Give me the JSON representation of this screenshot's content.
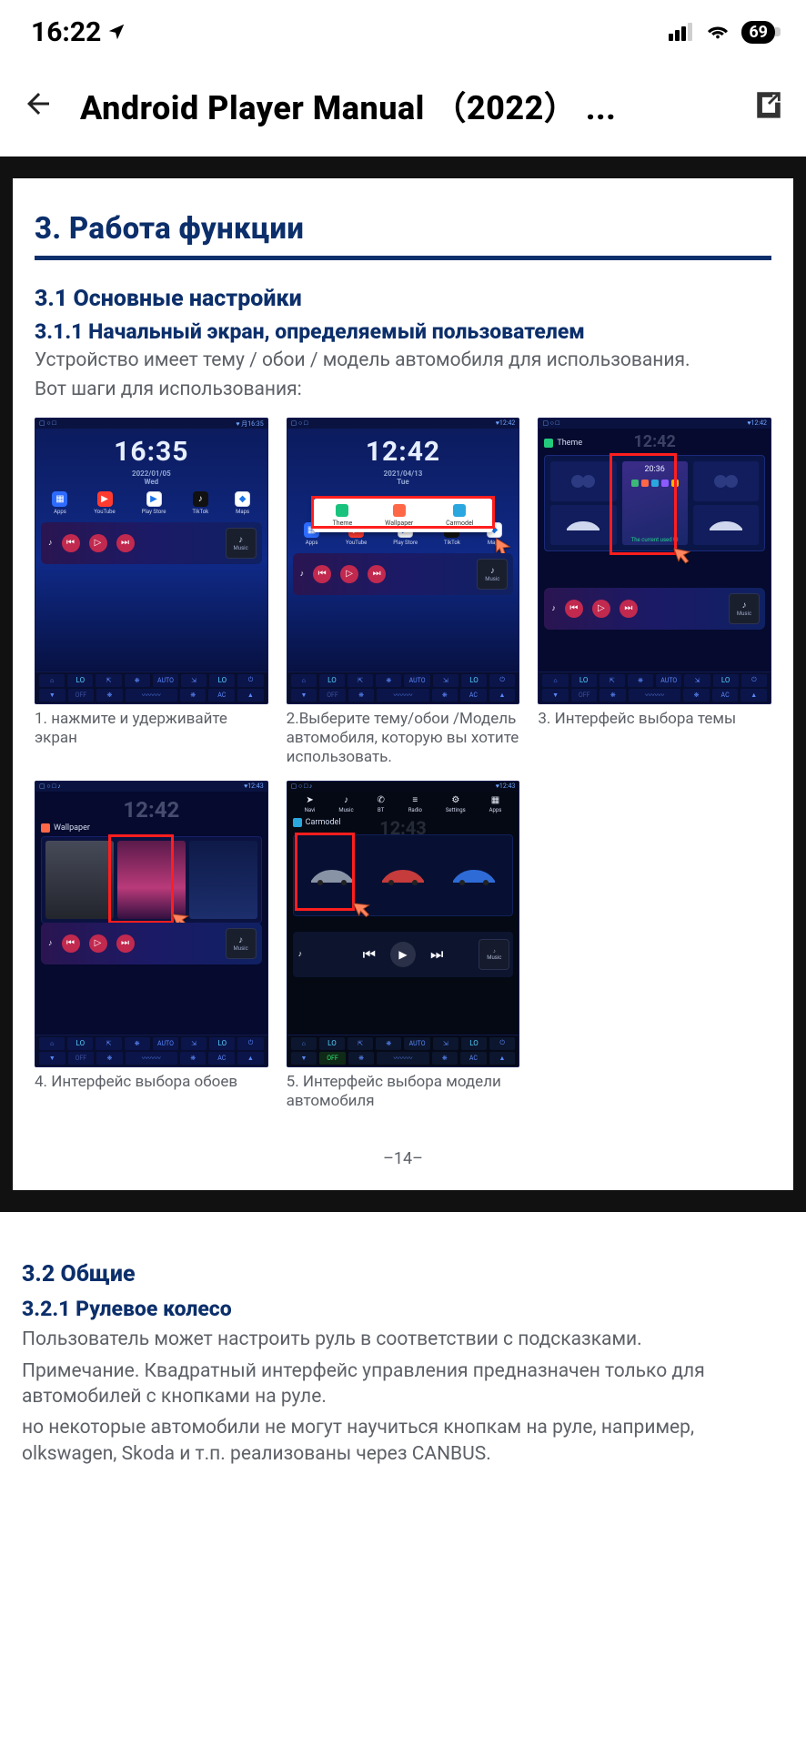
{
  "status": {
    "time": "16:22",
    "battery": "69"
  },
  "header": {
    "title": "Android Player Manual （2022） ..."
  },
  "doc": {
    "section3": "3. Работа функции",
    "s31": "3.1 Основные настройки",
    "s311": "3.1.1 Начальный экран, определяемый пользователем",
    "desc1": "Устройство имеет тему / обои / модель автомобиля для использования.",
    "desc2": "Вот шаги для использования:",
    "captions": [
      "1. нажмите и удерживайте экран",
      "2.Выберите тему/обои /Модель автомобиля, которую вы хотите использовать.",
      "3. Интерфейс выбора темы",
      "4. Интерфейс выбора обоев",
      "5. Интерфейс выбора модели автомобиля"
    ],
    "popup": {
      "theme": "Theme",
      "wallpaper": "Wallpaper",
      "carmodel": "Carmodel"
    },
    "labels": {
      "theme": "Theme",
      "wallpaper": "Wallpaper",
      "carmodel": "Carmodel"
    },
    "thumb1": {
      "time": "16:35",
      "date": "2022/01/05",
      "day": "Wed",
      "stat": "♥ 月16:35"
    },
    "thumb2": {
      "time": "12:42",
      "date": "2021/04/13",
      "day": "Tue",
      "stat": "♥12:42"
    },
    "thumb3": {
      "time": "12:42",
      "stat": "♥12:42"
    },
    "thumb4": {
      "time": "12:42",
      "stat": "♥12:43"
    },
    "thumb5": {
      "time": "12:43",
      "stat": "♥12:43"
    },
    "apps": [
      {
        "name": "Apps",
        "color": "#2d6bff",
        "glyph": "▦"
      },
      {
        "name": "YouTube",
        "color": "#ff3b30",
        "glyph": "▶"
      },
      {
        "name": "Play Store",
        "color": "#ffffff",
        "glyph": "▶"
      },
      {
        "name": "TikTok",
        "color": "#111",
        "glyph": "♪"
      },
      {
        "name": "Maps",
        "color": "#ffffff",
        "glyph": "◆"
      }
    ],
    "nav": [
      {
        "name": "Navi",
        "glyph": "➤"
      },
      {
        "name": "Music",
        "glyph": "♪"
      },
      {
        "name": "BT",
        "glyph": "✆"
      },
      {
        "name": "Radio",
        "glyph": "≡"
      },
      {
        "name": "Settings",
        "glyph": "⚙"
      },
      {
        "name": "Apps",
        "glyph": "▦"
      }
    ],
    "media_label": "Music",
    "hvac": {
      "lo": "LO",
      "off": "OFF",
      "ac": "AC",
      "auto": "AUTO"
    },
    "page": "–14–"
  },
  "after": {
    "s32": "3.2 Общие",
    "s321": "3.2.1 Рулевое колесо",
    "p1": "Пользователь может настроить руль в соответствии с подсказками.",
    "p2": "Примечание. Квадратный интерфейс управления предназначен только для автомобилей с кнопками на руле.",
    "p3": "но некоторые автомобили не могут научиться кнопкам на руле, например, olkswagen, Skoda и т.п. реализованы через CANBUS."
  }
}
